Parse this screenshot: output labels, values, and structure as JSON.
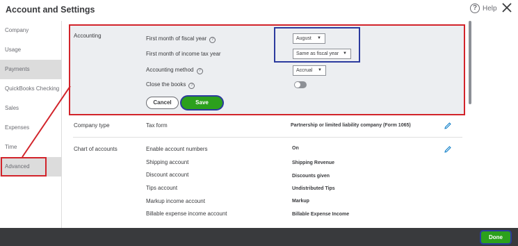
{
  "header": {
    "title": "Account and Settings",
    "help_label": "Help"
  },
  "sidebar": {
    "items": [
      {
        "label": "Company"
      },
      {
        "label": "Usage"
      },
      {
        "label": "Payments"
      },
      {
        "label": "QuickBooks Checking"
      },
      {
        "label": "Sales"
      },
      {
        "label": "Expenses"
      },
      {
        "label": "Time"
      },
      {
        "label": "Advanced"
      }
    ]
  },
  "accounting": {
    "section_label": "Accounting",
    "fiscal_year_label": "First month of fiscal year",
    "fiscal_year_value": "August",
    "tax_year_label": "First month of income tax year",
    "tax_year_value": "Same as fiscal year",
    "method_label": "Accounting method",
    "method_value": "Accrual",
    "close_books_label": "Close the books",
    "cancel_label": "Cancel",
    "save_label": "Save"
  },
  "company_type": {
    "section_label": "Company type",
    "field_label": "Tax form",
    "field_value": "Partnership or limited liability company (Form 1065)"
  },
  "chart_of_accounts": {
    "section_label": "Chart of accounts",
    "rows": [
      {
        "label": "Enable account numbers",
        "value": "On"
      },
      {
        "label": "Shipping account",
        "value": "Shipping Revenue"
      },
      {
        "label": "Discount account",
        "value": "Discounts given"
      },
      {
        "label": "Tips account",
        "value": "Undistributed Tips"
      },
      {
        "label": "Markup income account",
        "value": "Markup"
      },
      {
        "label": "Billable expense income account",
        "value": "Billable Expense Income"
      }
    ]
  },
  "footer": {
    "done_label": "Done"
  },
  "colors": {
    "accent_green": "#2ca01c",
    "annotation_red": "#d2232a",
    "annotation_blue": "#2b3a9e",
    "footer_bg": "#393a3d"
  }
}
